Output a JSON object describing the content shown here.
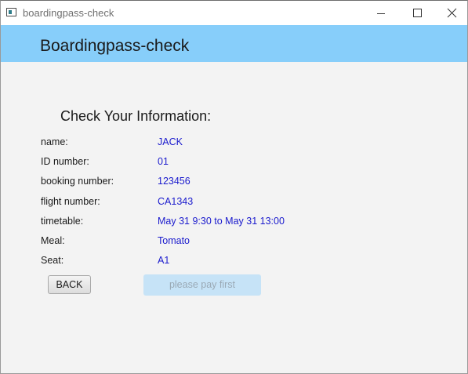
{
  "window": {
    "title": "boardingpass-check",
    "controls": {
      "minimize_icon": "minimize-icon",
      "maximize_icon": "maximize-icon",
      "close_icon": "close-icon"
    }
  },
  "header": {
    "title": "Boardingpass-check",
    "background": "#87cefa"
  },
  "main": {
    "heading": "Check Your Information:",
    "rows": [
      {
        "label": "name:",
        "value": "JACK"
      },
      {
        "label": "ID number:",
        "value": "01"
      },
      {
        "label": "booking number:",
        "value": "123456"
      },
      {
        "label": "flight number:",
        "value": "CA1343"
      },
      {
        "label": "timetable:",
        "value": "May 31 9:30 to May 31 13:00"
      },
      {
        "label": "Meal:",
        "value": "Tomato"
      },
      {
        "label": "Seat:",
        "value": "A1"
      }
    ],
    "value_color": "#1a1acd"
  },
  "actions": {
    "back_label": "BACK",
    "pay_label": "please pay first",
    "pay_disabled": true
  }
}
